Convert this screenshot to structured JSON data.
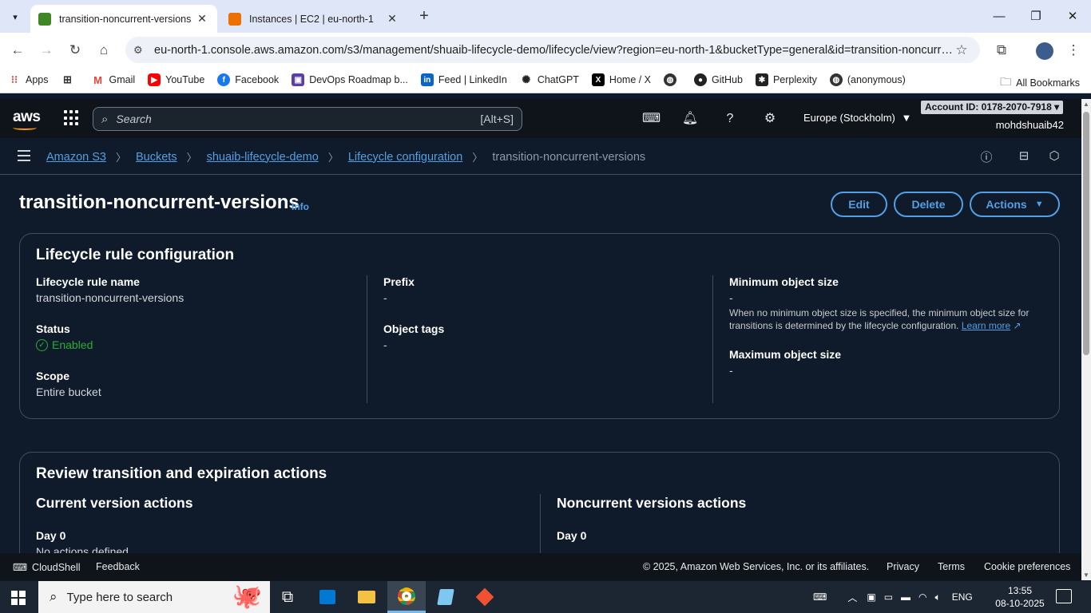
{
  "browser": {
    "tabs": [
      {
        "label": "transition-noncurrent-versions",
        "active": true
      },
      {
        "label": "Instances | EC2 | eu-north-1",
        "active": false
      }
    ],
    "url": "eu-north-1.console.aws.amazon.com/s3/management/shuaib-lifecycle-demo/lifecycle/view?region=eu-north-1&bucketType=general&id=transition-noncurre...",
    "bookmarks": [
      {
        "label": "Apps",
        "icon": "apps-grid-icon"
      },
      {
        "label": "",
        "icon": "tab-groups-icon"
      },
      {
        "label": "Gmail",
        "icon": "gmail-icon"
      },
      {
        "label": "YouTube",
        "icon": "youtube-icon"
      },
      {
        "label": "Facebook",
        "icon": "facebook-icon"
      },
      {
        "label": "DevOps Roadmap b...",
        "icon": "roadmap-icon"
      },
      {
        "label": "Feed | LinkedIn",
        "icon": "linkedin-icon"
      },
      {
        "label": "ChatGPT",
        "icon": "chatgpt-icon"
      },
      {
        "label": "Home / X",
        "icon": "x-icon"
      },
      {
        "label": "",
        "icon": "globe-icon"
      },
      {
        "label": "GitHub",
        "icon": "github-icon"
      },
      {
        "label": "Perplexity",
        "icon": "perplexity-icon"
      },
      {
        "label": "(anonymous)",
        "icon": "globe-icon"
      }
    ],
    "all_bookmarks": "All Bookmarks"
  },
  "aws": {
    "search_placeholder": "Search",
    "search_shortcut": "[Alt+S]",
    "region": "Europe (Stockholm)",
    "account_id": "Account ID: 0178-2070-7918",
    "username": "mohdshuaib42"
  },
  "breadcrumb": {
    "items": [
      "Amazon S3",
      "Buckets",
      "shuaib-lifecycle-demo",
      "Lifecycle configuration"
    ],
    "current": "transition-noncurrent-versions"
  },
  "page": {
    "title": "transition-noncurrent-versions",
    "info": "Info",
    "buttons": {
      "edit": "Edit",
      "delete": "Delete",
      "actions": "Actions"
    }
  },
  "config": {
    "heading": "Lifecycle rule configuration",
    "rule_name_label": "Lifecycle rule name",
    "rule_name_value": "transition-noncurrent-versions",
    "status_label": "Status",
    "status_value": "Enabled",
    "scope_label": "Scope",
    "scope_value": "Entire bucket",
    "prefix_label": "Prefix",
    "prefix_value": "-",
    "tags_label": "Object tags",
    "tags_value": "-",
    "min_size_label": "Minimum object size",
    "min_size_value": "-",
    "min_size_help": "When no minimum object size is specified, the minimum object size for transitions is determined by the lifecycle configuration.",
    "learn_more": "Learn more",
    "max_size_label": "Maximum object size",
    "max_size_value": "-"
  },
  "review": {
    "heading": "Review transition and expiration actions",
    "current_heading": "Current version actions",
    "current_day": "Day 0",
    "current_day_value": "No actions defined",
    "noncurrent_heading": "Noncurrent versions actions",
    "noncurrent_day": "Day 0"
  },
  "footer": {
    "cloudshell": "CloudShell",
    "feedback": "Feedback",
    "copyright": "© 2025, Amazon Web Services, Inc. or its affiliates.",
    "privacy": "Privacy",
    "terms": "Terms",
    "cookies": "Cookie preferences"
  },
  "taskbar": {
    "search_placeholder": "Type here to search",
    "language": "ENG",
    "time": "13:55",
    "date": "08-10-2025"
  },
  "colors": {
    "link": "#539fe5",
    "success": "#29ad32",
    "background": "#0f1b2a",
    "aws_orange": "#ff9900"
  }
}
